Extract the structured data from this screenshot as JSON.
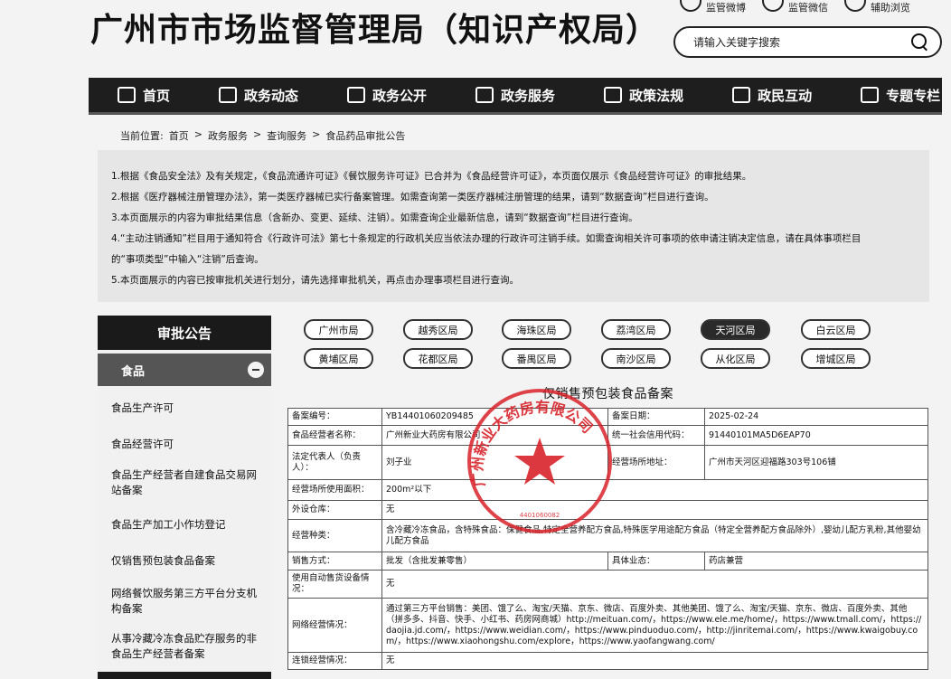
{
  "header": {
    "site_title": "广州市市场监督管理局（知识产权局）",
    "top_links": [
      "监管微博",
      "监管微信",
      "辅助浏览"
    ],
    "search_placeholder": "请输入关键字搜索"
  },
  "nav": {
    "items": [
      {
        "label": "首页",
        "icon": "home-icon"
      },
      {
        "label": "政务动态",
        "icon": "news-icon"
      },
      {
        "label": "政务公开",
        "icon": "open-icon"
      },
      {
        "label": "政务服务",
        "icon": "heart-icon"
      },
      {
        "label": "政策法规",
        "icon": "doc-icon"
      },
      {
        "label": "政民互动",
        "icon": "chat-icon"
      },
      {
        "label": "专题专栏",
        "icon": "gear-icon"
      }
    ]
  },
  "breadcrumb": {
    "prefix": "当前位置:",
    "items": [
      "首页",
      ">",
      "政务服务",
      ">",
      "查询服务",
      ">",
      "食品药品审批公告"
    ]
  },
  "notice": [
    "1.根据《食品安全法》及有关规定，《食品流通许可证》《餐饮服务许可证》已合并为《食品经营许可证》，本页面仅展示《食品经营许可证》的审批结果。",
    "2.根据《医疗器械注册管理办法》，第一类医疗器械已实行备案管理。如需查询第一类医疗器械注册管理的结果，请到“数据查询”栏目进行查询。",
    "3.本页面展示的内容为审批结果信息（含新办、变更、延续、注销）。如需查询企业最新信息，请到“数据查询”栏目进行查询。",
    "4.“主动注销通知”栏目用于通知符合《行政许可法》第七十条规定的行政机关应当依法办理的行政许可注销手续。如需查询相关许可事项的依申请注销决定信息，请在具体事项栏目",
    "的“事项类型”中输入“注销”后查询。",
    "5.本页面展示的内容已按审批机关进行划分，请先选择审批机关，再点击办理事项栏目进行查询。"
  ],
  "sidebar": {
    "title": "审批公告",
    "category": "食品",
    "items": [
      "食品生产许可",
      "食品经营许可",
      "食品生产经营者自建食品交易网站备案",
      "食品生产加工小作坊登记",
      "仅销售预包装食品备案",
      "网络餐饮服务第三方平台分支机构备案",
      "从事冷藏冷冻食品贮存服务的非食品生产经营者备案"
    ]
  },
  "districts": {
    "row1": [
      "广州市局",
      "越秀区局",
      "海珠区局",
      "荔湾区局",
      "天河区局",
      "白云区局"
    ],
    "row2": [
      "黄埔区局",
      "花都区局",
      "番禺区局",
      "南沙区局",
      "从化区局",
      "增城区局"
    ],
    "active": "天河区局"
  },
  "record": {
    "title": "仅销售预包装食品备案",
    "filing_no_label": "备案编号：",
    "filing_no": "YB14401060209485",
    "filing_date_label": "备案日期：",
    "filing_date": "2025-02-24",
    "operator_label": "食品经营者名称：",
    "operator": "广州新业大药房有限公司",
    "credit_code_label": "统一社会信用代码：",
    "credit_code": "91440101MA5D6EAP70",
    "legal_rep_label": "法定代表人（负责人）：",
    "legal_rep": "刘子业",
    "address_label": "经营场所地址：",
    "address": "广州市天河区迎福路303号106铺",
    "area_label": "经营场所使用面积：",
    "area": "200m²以下",
    "warehouse_label": "外设仓库：",
    "warehouse": "无",
    "category_label": "经营种类：",
    "category": "含冷藏冷冻食品，含特殊食品：保健食品,特定全营养配方食品,特殊医学用途配方食品（特定全营养配方食品除外）,婴幼儿配方乳粉,其他婴幼儿配方食品",
    "sales_mode_label": "销售方式：",
    "sales_mode": "批发（含批发兼零售）",
    "format_label": "具体业态：",
    "format": "药店兼营",
    "vending_label": "使用自动售货设备情况：",
    "vending": "无",
    "online_label": "网络经营情况：",
    "online": "通过第三方平台销售：美团、饿了么、淘宝/天猫、京东、微店、百度外卖、其他美团、饿了么、淘宝/天猫、京东、微店、百度外卖、其他（拼多多、抖音、快手、小红书、药房网商城）http://meituan.com/，https://www.ele.me/home/，https://www.tmall.com/，https://daojia.jd.com/，https://www.weidian.com/，https://www.pinduoduo.com/，http://jinritemai.com/，https://www.kwaigobuy.com/，https://www.xiaohongshu.com/explore，https://www.yaofangwang.com/",
    "chain_label": "连锁经营情况：",
    "chain": "无"
  },
  "stamp": {
    "text": "广州新业大药房有限公司",
    "number": "4401060082",
    "color": "#d8222a"
  }
}
